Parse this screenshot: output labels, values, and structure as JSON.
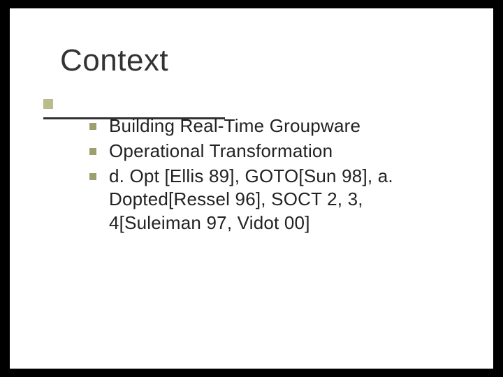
{
  "slide": {
    "title": "Context",
    "bullets": [
      "Building Real-Time Groupware",
      "Operational Transformation",
      "d. Opt [Ellis 89], GOTO[Sun 98], a. Dopted[Ressel 96], SOCT 2, 3, 4[Suleiman 97, Vidot 00]"
    ]
  }
}
